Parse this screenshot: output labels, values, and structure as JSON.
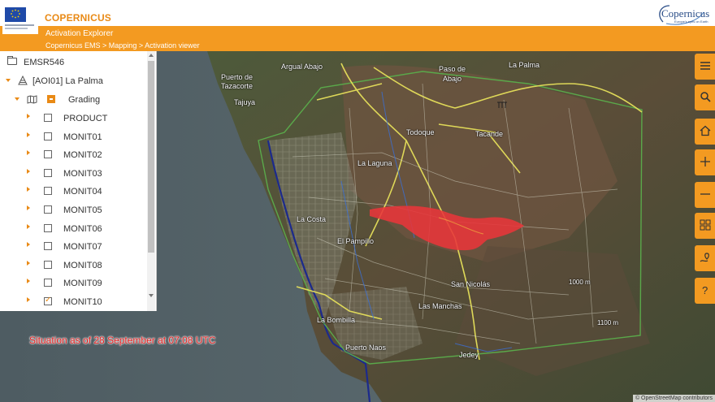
{
  "header": {
    "brand": "COPERNICUS",
    "subtitle": "Activation Explorer",
    "breadcrumb": [
      "Copernicus EMS",
      "Mapping",
      "Activation viewer"
    ],
    "breadcrumb_sep": " > ",
    "logo_right_word": "Copernicus",
    "logo_right_sub": "Europe's eyes on Earth"
  },
  "tree": {
    "root_label": "EMSR546",
    "aoi_label": "[AOI01] La Palma",
    "group_label": "Grading",
    "items": [
      {
        "label": "PRODUCT",
        "checked": false
      },
      {
        "label": "MONIT01",
        "checked": false
      },
      {
        "label": "MONIT02",
        "checked": false
      },
      {
        "label": "MONIT03",
        "checked": false
      },
      {
        "label": "MONIT04",
        "checked": false
      },
      {
        "label": "MONIT05",
        "checked": false
      },
      {
        "label": "MONIT06",
        "checked": false
      },
      {
        "label": "MONIT07",
        "checked": false
      },
      {
        "label": "MONIT08",
        "checked": false
      },
      {
        "label": "MONIT09",
        "checked": false
      },
      {
        "label": "MONIT10",
        "checked": true
      }
    ]
  },
  "map": {
    "situation_text": "Situation as of 28 September at 07:08 UTC",
    "attribution": "© OpenStreetMap contributors",
    "place_labels": {
      "argual": "Argual Abajo",
      "puerto": "Puerto de",
      "tazacorte": "Tazacorte",
      "tajuya": "Tajuya",
      "pasode": "Paso de",
      "abajo": "Abajo",
      "lapalma": "La Palma",
      "lalaguna": "La Laguna",
      "tacande": "Tacande",
      "todoque": "Todoque",
      "lacosta": "La Costa",
      "elpampillo": "El Pampillo",
      "sannicolas": "San Nicolás",
      "lasmanchas": "Las Manchas",
      "puertonaos": "Puerto Naos",
      "jedey": "Jedey",
      "laramplas": "La Bombilla",
      "c1000": "1000 m",
      "c1100": "1100 m"
    }
  },
  "toolbar": {
    "buttons": [
      "menu-icon",
      "search-icon",
      "home-icon",
      "zoom-in-icon",
      "zoom-out-icon",
      "grid-icon",
      "location-pin-icon",
      "help-icon"
    ]
  },
  "colors": {
    "accent": "#f39a21",
    "brand_text": "#e98a16",
    "lava": "#e8363a",
    "aoi_border": "#5aa84a",
    "coastline": "#1c2a8c",
    "roads": "#e6e05a"
  }
}
